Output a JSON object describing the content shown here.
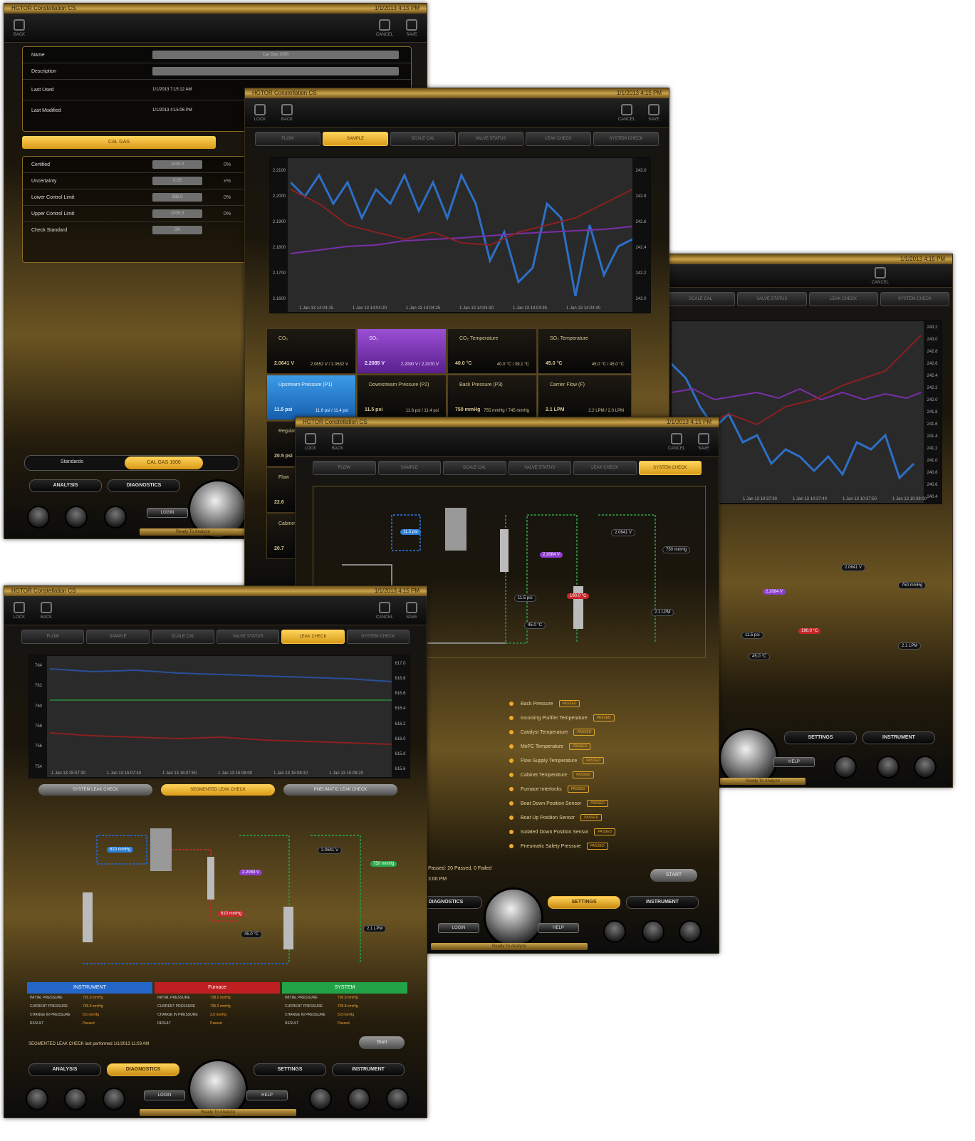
{
  "common": {
    "title": "HGTOR Constellation CS",
    "status": "1/1/2013  4:15 PM",
    "lock": "LOCK",
    "back": "BACK",
    "cancel": "CANCEL",
    "save": "SAVE",
    "analysis": "ANALYSIS",
    "diagnostics": "DIAGNOSTICS",
    "settings": "SETTINGS",
    "instrument": "INSTRUMENT",
    "login": "LOGIN",
    "help": "HELP",
    "ready": "Ready To Analyze"
  },
  "tabs": [
    "FLOW",
    "SAMPLE",
    "SCALE CAL",
    "VALVE STATUS",
    "LEAK CHECK",
    "SYSTEM CHECK"
  ],
  "win1": {
    "fields": [
      {
        "label": "Name",
        "value": "Cal Gas 1000"
      },
      {
        "label": "Description",
        "value": ""
      },
      {
        "label": "Last Used",
        "value": "1/1/2013 7:15:12 AM"
      },
      {
        "label": "Last Modified",
        "value": "1/1/2013 4:15:06 PM"
      }
    ],
    "section_button": "CAL GAS",
    "rows": [
      {
        "label": "Certified",
        "value": "1000.0",
        "unit": "0%"
      },
      {
        "label": "Uncertainty",
        "value": "0.05",
        "unit": "±%"
      },
      {
        "label": "Lower Control Limit",
        "value": "995.0",
        "unit": "0%"
      },
      {
        "label": "Upper Control Limit",
        "value": "1005.0",
        "unit": "0%"
      },
      {
        "label": "Check Standard",
        "value": "ON",
        "unit": ""
      }
    ],
    "standards_label": "Standards",
    "standards_value": "CAL GAS 1000"
  },
  "win2": {
    "left_axis": [
      "2.2100",
      "2.2000",
      "2.1900",
      "2.1800",
      "2.1700",
      "2.1600"
    ],
    "right_axis": [
      "243.0",
      "242.8",
      "242.6",
      "242.4",
      "242.2",
      "242.0"
    ],
    "x_labels": [
      "1 Jan 13 14:04:15",
      "1 Jan 13 14:04:20",
      "1 Jan 13 14:04:25",
      "1 Jan 13 14:04:30",
      "1 Jan 13 14:04:35",
      "1 Jan 13 14:04:40"
    ],
    "cards": [
      {
        "title": "CO₂",
        "value": "2.0641 V",
        "range": "2.0652 V / 2.0632 V"
      },
      {
        "title": "SO₂",
        "value": "2.2085 V",
        "range": "2.2090 V / 2.2070 V"
      },
      {
        "title": "CO₂ Temperature",
        "value": "40.0 °C",
        "range": "40.0 °C / 39.1 °C"
      },
      {
        "title": "SO₂ Temperature",
        "value": "45.0 °C",
        "range": "45.0 °C / 45.0 °C"
      },
      {
        "title": "Upstream Pressure (P1)",
        "value": "11.5 psi",
        "range": "11.6 psi / 11.4 psi"
      },
      {
        "title": "Downstream Pressure (P2)",
        "value": "11.5 psi",
        "range": "11.6 psi / 11.4 psi"
      },
      {
        "title": "Back Pressure (P3)",
        "value": "750 mmHg",
        "range": "755 mmHg / 745 mmHg"
      },
      {
        "title": "Carrier Flow (F)",
        "value": "2.1 LPM",
        "range": "2.2 LPM / 2.0 LPM"
      }
    ],
    "side_cards": [
      {
        "title": "Regulator",
        "value": "20.5 psi"
      },
      {
        "title": "Flow",
        "value": "22.6"
      },
      {
        "title": "Cabinet",
        "value": "20.7"
      }
    ]
  },
  "win3": {
    "axis": [
      "243.2",
      "243.0",
      "242.8",
      "242.6",
      "242.4",
      "242.2",
      "242.0",
      "241.8",
      "241.6",
      "241.4",
      "241.2",
      "241.0",
      "240.8",
      "240.6",
      "240.4"
    ],
    "x_labels": [
      "1 Jan 13 10:37:30",
      "1 Jan 13 10:37:40",
      "1 Jan 13 10:37:50",
      "1 Jan 13 10:38:00"
    ],
    "badges": {
      "co2": "2.0641 V",
      "so2": "2.2084 V",
      "temp": "190.0 °C",
      "flow_ctrl": "45.0 °C",
      "pressure": "750 mmHg",
      "p1": "11.5 psi",
      "lpm": "2.1 LPM"
    }
  },
  "win4": {
    "badges": {
      "p1": "11.5 psi",
      "so2": "2.2084 V",
      "co2": "2.0641 V",
      "pressure": "750 mmHg",
      "temp": "190.0 °C",
      "mfc": "45.0 °C",
      "p2": "11.5 psi",
      "lpm": "2.1 LPM"
    },
    "diagnostics": [
      {
        "label": "Back Pressure",
        "tag": "PASSED"
      },
      {
        "label": "Incoming Purifier Temperature",
        "tag": "PASSED"
      },
      {
        "label": "Catalyst Temperature",
        "tag": "PASSED"
      },
      {
        "label": "MeFC Temperature",
        "tag": "PASSED"
      },
      {
        "label": "Flow Supply Temperature",
        "tag": "PASSED"
      },
      {
        "label": "Cabinet Temperature",
        "tag": "PASSED"
      },
      {
        "label": "Furnace Interlocks",
        "tag": "PASSED"
      },
      {
        "label": "Boat Down Position Sensor",
        "tag": "PASSED"
      },
      {
        "label": "Boat Up Position Sensor",
        "tag": "PASSED"
      },
      {
        "label": "Isolated Down Position Sensor",
        "tag": "PASSED"
      },
      {
        "label": "Pneumatic Safety Pressure",
        "tag": "PASSED"
      }
    ],
    "summary": "Passed: 20 Passed, 0 Failed",
    "summary_time": "3:00 PM",
    "start_button": "START"
  },
  "win5": {
    "left_axis": [
      "764",
      "762",
      "760",
      "758",
      "756",
      "754"
    ],
    "right_axis": [
      "617.0",
      "616.8",
      "616.6",
      "616.4",
      "616.2",
      "616.0",
      "615.8",
      "615.6"
    ],
    "x_labels": [
      "1 Jan 13 15:07:30",
      "1 Jan 13 15:07:40",
      "1 Jan 13 15:07:50",
      "1 Jan 13 15:08:00",
      "1 Jan 13 15:08:10",
      "1 Jan 13 15:08:20"
    ],
    "buttons": [
      "SYSTEM LEAK CHECK",
      "SEGMENTED LEAK CHECK",
      "PNEUMATIC LEAK CHECK"
    ],
    "badges": {
      "p1": "610 mmHg",
      "so2": "2.2084 V",
      "co2": "2.0641 V",
      "pressure": "750 mmHg",
      "red": "610 mmHg",
      "temp": "45.0 °C",
      "lpm": "2.1 LPM"
    },
    "results": [
      {
        "head": "INSTRUMENT",
        "color": "#2467c9",
        "rows": [
          [
            "INITIAL PRESSURE",
            "735.0 mmHg"
          ],
          [
            "CURRENT PRESSURE",
            "735.5 mmHg"
          ],
          [
            "CHANGE IN PRESSURE",
            "0.5 mmHg"
          ],
          [
            "RESULT",
            "Passed"
          ]
        ]
      },
      {
        "head": "Furnace",
        "color": "#c01f22",
        "rows": [
          [
            "INITIAL PRESSURE",
            "738.0 mmHg"
          ],
          [
            "CURRENT PRESSURE",
            "735.0 mmHg"
          ],
          [
            "CHANGE IN PRESSURE",
            "3.0 mmHg"
          ],
          [
            "RESULT",
            "Passed"
          ]
        ]
      },
      {
        "head": "SYSTEM",
        "color": "#22a347",
        "rows": [
          [
            "INITIAL PRESSURE",
            "700.0 mmHg"
          ],
          [
            "CURRENT PRESSURE",
            "705.8 mmHg"
          ],
          [
            "CHANGE IN PRESSURE",
            "5.8 mmHg"
          ],
          [
            "RESULT",
            "Passed"
          ]
        ]
      }
    ],
    "status_line": "SEGMENTED LEAK CHECK last performed 1/1/2013 11:03 AM",
    "start_button": "Start"
  }
}
